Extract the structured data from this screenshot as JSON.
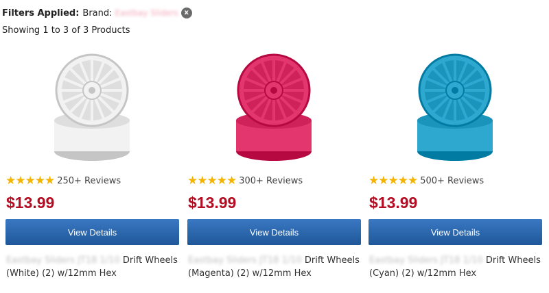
{
  "filters": {
    "label": "Filters Applied:",
    "brand_label": "Brand:",
    "brand_value": "Eastbay Sliders",
    "remove_icon": "x"
  },
  "showing": "Showing 1 to 3 of 3 Products",
  "products": [
    {
      "color": "#f2f2f2",
      "stars": "★★★★★",
      "reviews": "250+ Reviews",
      "price": "$13.99",
      "button": "View Details",
      "brand_name": "Eastbay Sliders JT18 1/10",
      "title": "Drift Wheels (White) (2) w/12mm Hex"
    },
    {
      "color": "#e3366e",
      "stars": "★★★★★",
      "reviews": "300+ Reviews",
      "price": "$13.99",
      "button": "View Details",
      "brand_name": "Eastbay Sliders JT18 1/10",
      "title": "Drift Wheels (Magenta) (2) w/12mm Hex"
    },
    {
      "color": "#2fa8d0",
      "stars": "★★★★★",
      "reviews": "500+ Reviews",
      "price": "$13.99",
      "button": "View Details",
      "brand_name": "Eastbay Sliders JT18 1/10",
      "title": "Drift Wheels (Cyan) (2) w/12mm Hex"
    }
  ]
}
